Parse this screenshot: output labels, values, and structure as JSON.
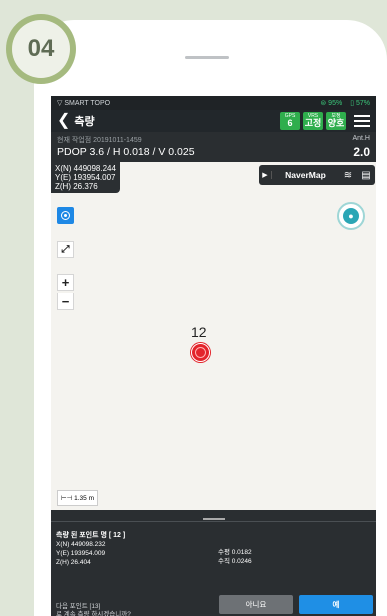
{
  "step": "04",
  "status": {
    "app": "▽ SMART TOPO",
    "battery1": "⊜ 95%",
    "battery2": "▯ 57%"
  },
  "appbar": {
    "back_icon": "chevron-left-icon",
    "title": "측량",
    "badges": [
      {
        "top": "GPS",
        "value": "6"
      },
      {
        "top": "VRS",
        "value": "고정"
      },
      {
        "top": "보정",
        "value": "양호"
      }
    ]
  },
  "info": {
    "point": "현재 작업점 20191011-1459",
    "pdop": "PDOP 3.6 / H 0.018 / V 0.025",
    "ant_label": "Ant.H",
    "ant_value": "2.0"
  },
  "map": {
    "coords": [
      "X(N) 449098.244",
      "Y(E) 193954.007",
      "Z(H) 26.376"
    ],
    "map_name": "NaverMap",
    "point_label": "12",
    "scale": "1.35 m",
    "zoom_in": "+",
    "zoom_out": "−"
  },
  "panel": {
    "title": "측량 된 포인트 명 [ 12 ]",
    "coords": [
      "X(N) 449098.232",
      "Y(E) 193954.009",
      "Z(H) 26.404"
    ],
    "horizontal": "수평 0.0182",
    "vertical": "수직 0.0246",
    "next_point": "다음 포인트 [13]",
    "question": "로 계속 측량 하시겠습니까?",
    "no_label": "아니요",
    "yes_label": "예"
  },
  "colors": {
    "accent": "#1f8fe5",
    "badge_green": "#2fae4d",
    "step_ring": "#a5ba7f"
  }
}
